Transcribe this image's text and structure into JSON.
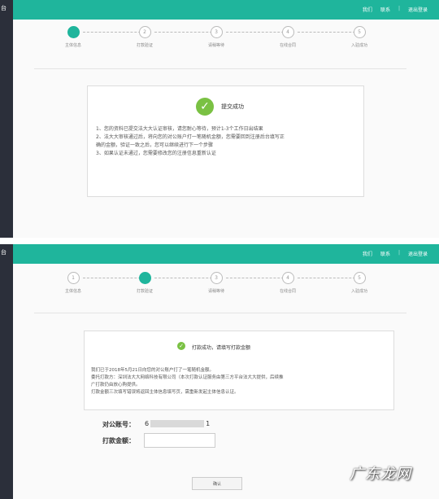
{
  "app": {
    "left_label": "台"
  },
  "header": {
    "links": [
      "我们",
      "联系",
      "退出登录"
    ]
  },
  "steps": [
    "主体信息",
    "打款验证",
    "请稍等待",
    "在线合同",
    "入驻成功"
  ],
  "screen1": {
    "active_step": 1,
    "success_title": "提交成功",
    "lines": [
      "1、您的资料已提交法大大认证审核，请您耐心等待，预计1-3个工作日出结果",
      "2、法大大审核通过后，将向您的对公账户打一笔随机金额，您需要回到注册后台填写正",
      "确的金额，验证一致之后，您可以继续进行下一个步骤",
      "3、如果认证未通过，您需要修改您的注册信息重新认证"
    ]
  },
  "screen2": {
    "active_step": 2,
    "success_title": "打款成功，请填写打款金额",
    "lines": [
      "我们已于2018年5月21日向您的对公账户打了一笔随机金额。",
      "委托打款方：深圳法大大网络科技有限公司（本次打款认证服务由第三方平台法大大提供，后续推",
      "广打款仍由放心购提供。",
      "打款金额三次填写错误将返回主体信息填写页，需重新发起主体信息认证。"
    ],
    "account_label": "对公账号：",
    "account_prefix": "6",
    "account_suffix": "1",
    "amount_label": "打款金额：",
    "amount_value": "",
    "submit_label": "确认"
  },
  "watermark": "广东龙网"
}
